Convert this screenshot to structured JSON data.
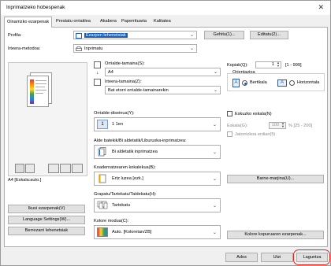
{
  "window": {
    "title": "Inprimatzeko hobespenak",
    "close_symbol": "✕"
  },
  "tabs": [
    "Oinarrizko ezarpenak",
    "Prestatu orriaklea",
    "Akabera",
    "Paperrituaria",
    "Kalitatea"
  ],
  "profile": {
    "label": "Profila:",
    "value": "Ezarpen lehenetsiak",
    "add_button": "Gehitu(1)...",
    "edit_button": "Editatu(2)..."
  },
  "output_method": {
    "label": "Irteera-metodoa:",
    "value": "Inprimatu"
  },
  "preview_caption": "A4 [Eskala:auto.]",
  "left_buttons": {
    "view_settings": "Ikusi ezarpenak(V)",
    "language_settings": "Language Settings(W)...",
    "restore_defaults": "Berrezarri lehenetsiak"
  },
  "page_size": {
    "label": "Orrialde-tamaina(S):",
    "value": "A4"
  },
  "output_size": {
    "label": "Irteera-tamaina(Z):",
    "value": "Bat etorri orrialde-tamainarekin"
  },
  "copies": {
    "label": "Kopiak(Q):",
    "value": "1",
    "range": "[1 - 999]"
  },
  "orientation": {
    "label": "Orientazioa",
    "portrait": "Bertikala",
    "landscape": "Horizontala"
  },
  "page_layout": {
    "label": "Orrialde-diseinua(Y):",
    "value": "1 1en"
  },
  "manual_scaling": {
    "label": "Eskuzko eskala(N)",
    "scale_label": "Eskala(G):",
    "scale_value": "100",
    "scale_range": "% [25 - 200]",
    "watermark_label": "Jatorrizkoa erdian(5)"
  },
  "duplex": {
    "label": "Alde batekik/Bi aldetatik/Liburuxka-inprimatzea:",
    "value": "Bi aldetatik inprimatzea"
  },
  "binding": {
    "label": "Koadernatzearen kokalekua(B):",
    "value": "Ertz luzea [ezk.]",
    "margin_button": "Barne-marjina(U)..."
  },
  "stapling": {
    "label": "Grapatu/Tartekatu/Taldekatu(H):",
    "value": "Tartekatu"
  },
  "color_mode": {
    "label": "Kolore modua(C):",
    "value": "Auto. [Koloretan/ZB]",
    "color_settings_button": "Kolore kopuruaren ezarpenak..."
  },
  "footer": {
    "ok": "Ados",
    "cancel": "Utzi",
    "help": "Laguntza"
  },
  "colors": {
    "accent": "#1a5fb4",
    "highlight_ring": "#d9261c"
  }
}
